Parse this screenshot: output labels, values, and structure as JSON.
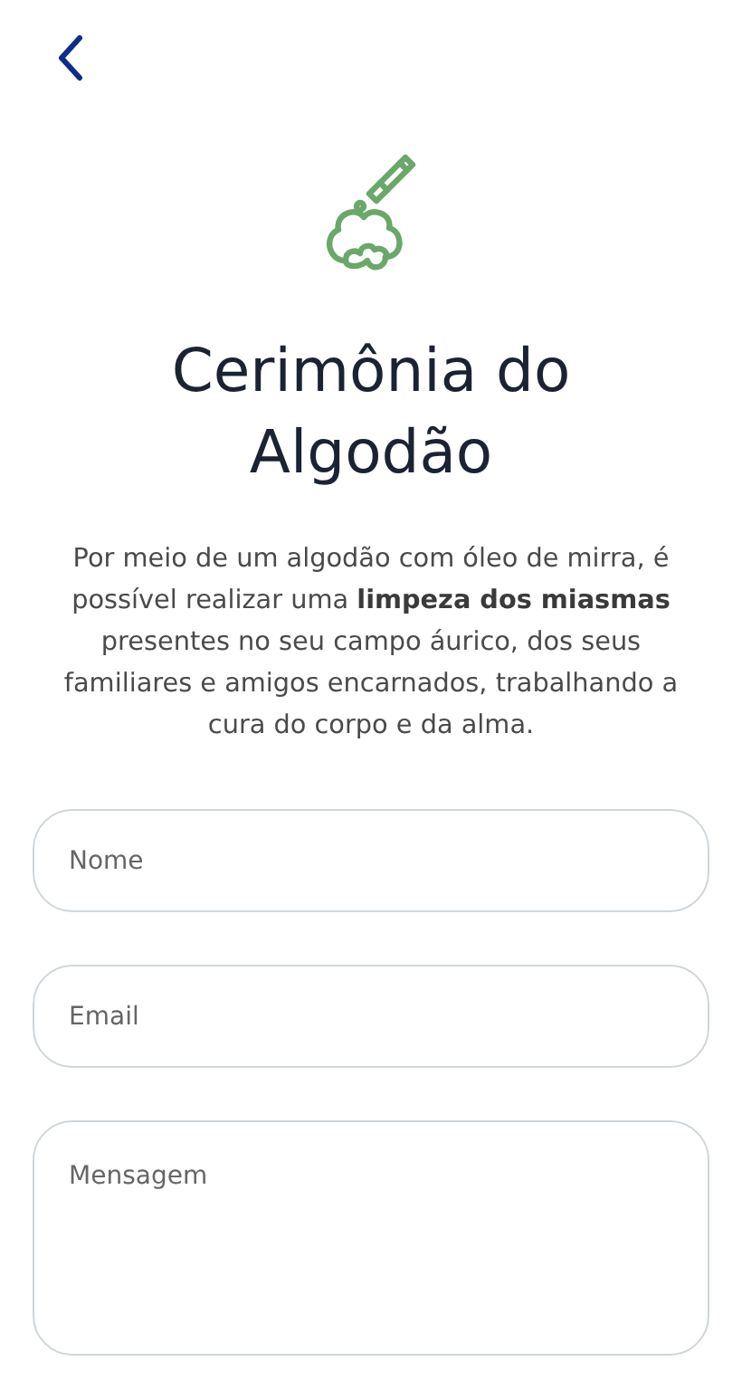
{
  "title": "Cerimônia do Algodão",
  "description": "Por meio de um algodão com óleo de mirra, é possível realizar uma **limpeza dos miasmas** presentes no seu campo áurico, dos seus familiares e amigos encarnados, trabalhando a cura do corpo e da alma.",
  "fields": [
    {
      "kind": "input",
      "placeholder": "Nome"
    },
    {
      "kind": "input",
      "placeholder": "Email"
    },
    {
      "kind": "textarea",
      "placeholder": "Mensagem"
    }
  ]
}
